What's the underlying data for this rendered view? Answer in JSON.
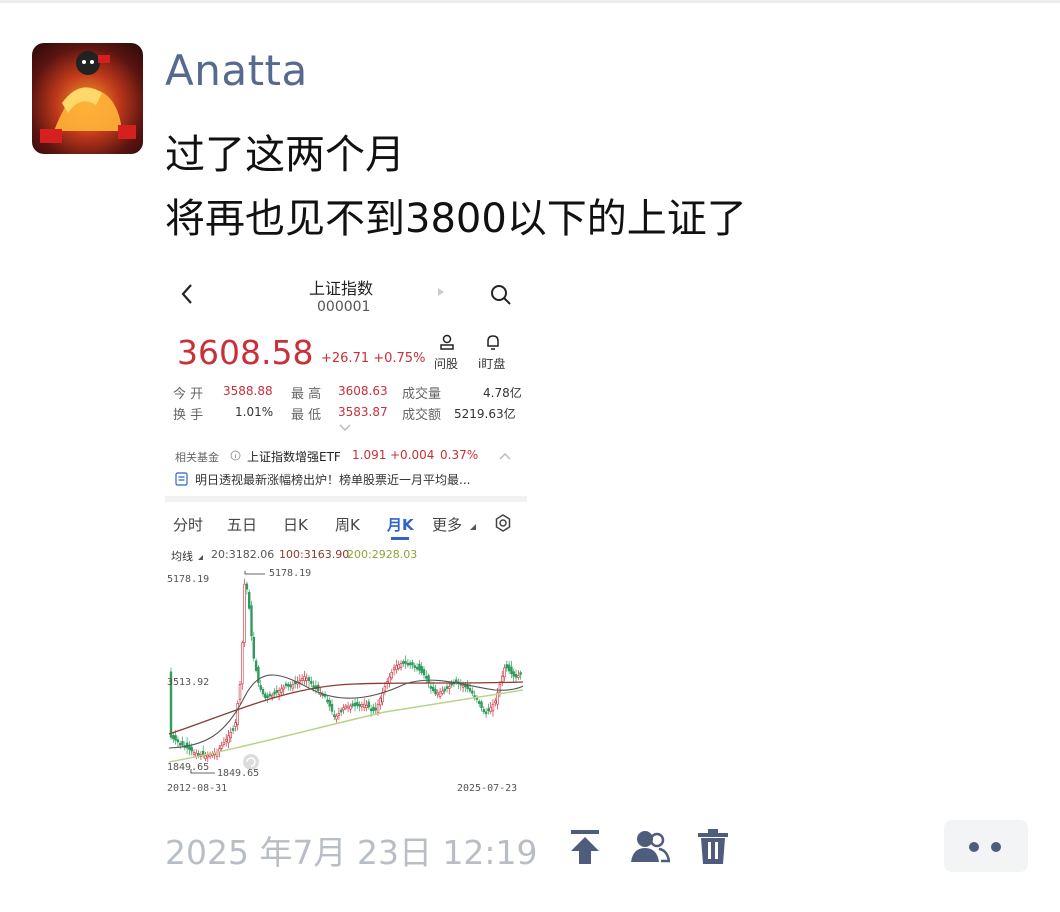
{
  "post": {
    "username": "Anatta",
    "text_line1": "过了这两个月",
    "text_line2": "将再也见不到3800以下的上证了",
    "timestamp": "2025 年7月 23日 12:19"
  },
  "screenshot": {
    "title": "上证指数",
    "code": "000001",
    "price": "3608.58",
    "change": "+26.71 +0.75%",
    "ask_stock_label": "问股",
    "order_label": "i盯盘",
    "stats": {
      "open_label": "今  开",
      "open_value": "3588.88",
      "high_label": "最  高",
      "high_value": "3608.63",
      "volume_label": "成交量",
      "volume_value": "4.78亿",
      "turnover_label": "换  手",
      "turnover_value": "1.01%",
      "low_label": "最  低",
      "low_value": "3583.87",
      "amount_label": "成交额",
      "amount_value": "5219.63亿"
    },
    "fund": {
      "label": "相关基金",
      "name": "上证指数增强ETF",
      "price": "1.091",
      "change": "+0.004",
      "pct": "0.37%"
    },
    "news": "明日透视最新涨幅榜出炉！榜单股票近一月平均最...",
    "tabs": [
      "分时",
      "五日",
      "日K",
      "周K",
      "月K",
      "更多"
    ],
    "ma_label": "均线",
    "ma20": "20:3182.06",
    "ma100": "100:3163.90",
    "ma200": "200:2928.03",
    "chart_labels": {
      "high_axis": "5178.19",
      "high_marker": "5178.19",
      "mid_axis": "3513.92",
      "low_axis": "1849.65",
      "low_marker": "1849.65",
      "start_date": "2012-08-31",
      "end_date": "2025-07-23"
    },
    "colors": {
      "up": "#c8303a",
      "down": "#2e9b5a",
      "accent": "#2f63c8"
    }
  },
  "actions": {
    "icons": [
      "pin-top-icon",
      "friends-icon",
      "trash-icon",
      "more-dots-icon"
    ],
    "link_color": "#4e5d7e"
  }
}
